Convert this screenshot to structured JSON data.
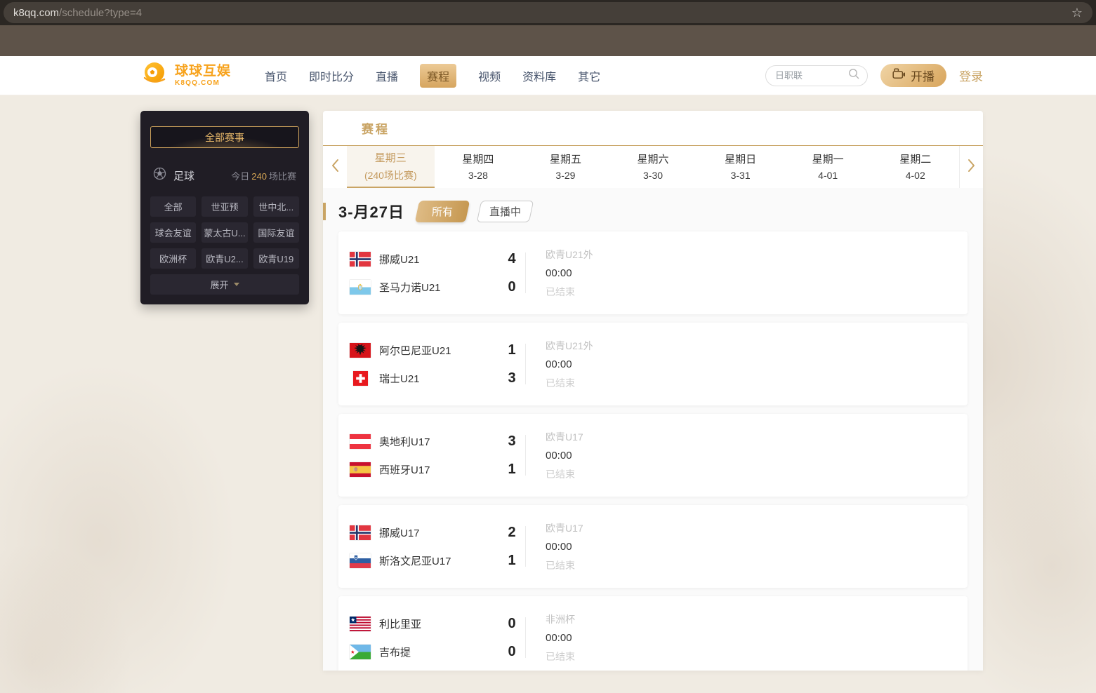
{
  "browser": {
    "url_domain": "k8qq.com",
    "url_path": "/schedule?type=4",
    "bookmark_star": "☆"
  },
  "header": {
    "logo_title": "球球互娱",
    "logo_domain": "K8QQ.COM",
    "nav": [
      {
        "label": "首页",
        "active": false
      },
      {
        "label": "即时比分",
        "active": false
      },
      {
        "label": "直播",
        "active": false
      },
      {
        "label": "赛程",
        "active": true
      },
      {
        "label": "视频",
        "active": false
      },
      {
        "label": "资料库",
        "active": false
      },
      {
        "label": "其它",
        "active": false
      }
    ],
    "search_placeholder": "日职联",
    "broadcast_label": "开播",
    "login_label": "登录"
  },
  "sidebar": {
    "all_events_label": "全部赛事",
    "sport_icon": "soccer-ball-icon",
    "sport_name": "足球",
    "today_prefix": "今日",
    "today_count": "240",
    "today_suffix": "场比赛",
    "filters": [
      "全部",
      "世亚预",
      "世中北...",
      "球会友谊",
      "蒙太古U...",
      "国际友谊",
      "欧洲杯",
      "欧青U2...",
      "欧青U19"
    ],
    "expand_label": "展开"
  },
  "main": {
    "panel_title": "赛程",
    "tabs": [
      {
        "day": "星期三",
        "sub": "(240场比赛)",
        "active": true
      },
      {
        "day": "星期四",
        "sub": "3-28",
        "active": false
      },
      {
        "day": "星期五",
        "sub": "3-29",
        "active": false
      },
      {
        "day": "星期六",
        "sub": "3-30",
        "active": false
      },
      {
        "day": "星期日",
        "sub": "3-31",
        "active": false
      },
      {
        "day": "星期一",
        "sub": "4-01",
        "active": false
      },
      {
        "day": "星期二",
        "sub": "4-02",
        "active": false
      }
    ],
    "date_heading": "3-月27日",
    "filter_all_label": "所有",
    "filter_live_label": "直播中",
    "matches": [
      {
        "home": {
          "name": "挪威U21",
          "flag": "norway",
          "score": "4"
        },
        "away": {
          "name": "圣马力诺U21",
          "flag": "san_marino",
          "score": "0"
        },
        "league": "欧青U21外",
        "time": "00:00",
        "status": "已结束"
      },
      {
        "home": {
          "name": "阿尔巴尼亚U21",
          "flag": "albania",
          "score": "1"
        },
        "away": {
          "name": "瑞士U21",
          "flag": "switzerland",
          "score": "3"
        },
        "league": "欧青U21外",
        "time": "00:00",
        "status": "已结束"
      },
      {
        "home": {
          "name": "奥地利U17",
          "flag": "austria",
          "score": "3"
        },
        "away": {
          "name": "西班牙U17",
          "flag": "spain",
          "score": "1"
        },
        "league": "欧青U17",
        "time": "00:00",
        "status": "已结束"
      },
      {
        "home": {
          "name": "挪威U17",
          "flag": "norway",
          "score": "2"
        },
        "away": {
          "name": "斯洛文尼亚U17",
          "flag": "slovenia",
          "score": "1"
        },
        "league": "欧青U17",
        "time": "00:00",
        "status": "已结束"
      },
      {
        "home": {
          "name": "利比里亚",
          "flag": "liberia",
          "score": "0"
        },
        "away": {
          "name": "吉布提",
          "flag": "djibouti",
          "score": "0"
        },
        "league": "非洲杯",
        "time": "00:00",
        "status": "已结束"
      }
    ]
  },
  "colors": {
    "accent": "#c9a464",
    "active_nav_text": "#7a5624",
    "gold_button_top": "#f0d4a5",
    "gold_button_bottom": "#d8a55c",
    "sidebar_panel": "#201d25",
    "page_background": "#f0ebe2",
    "count_highlight": "#d9a855",
    "logo_orange": "#f7a21b"
  }
}
